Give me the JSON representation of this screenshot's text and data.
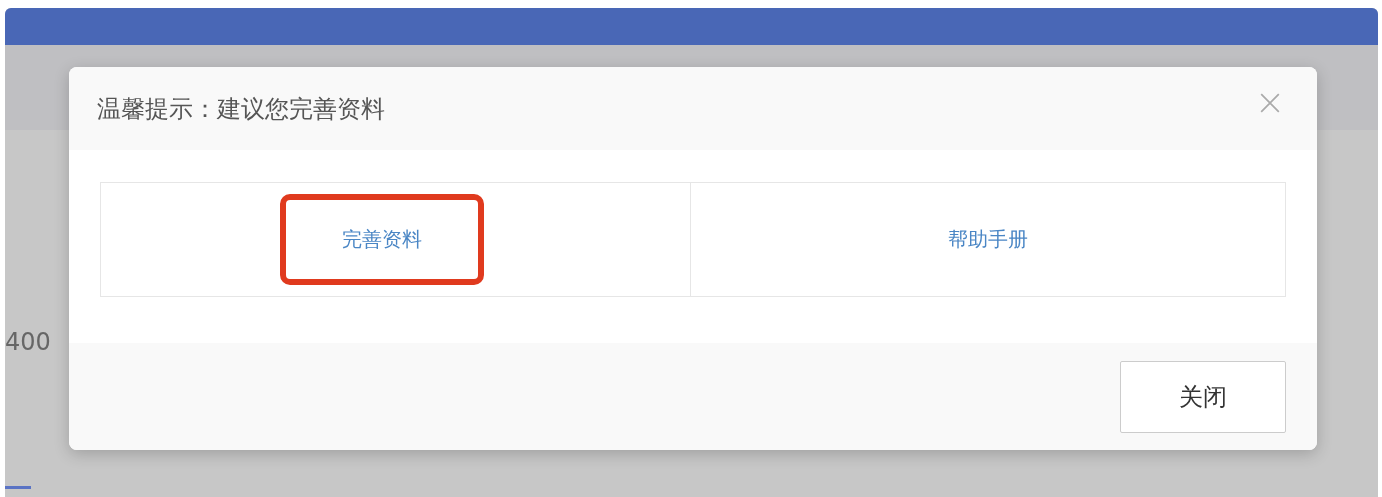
{
  "background": {
    "axis_label": "400"
  },
  "dialog": {
    "title": "温馨提示：建议您完善资料",
    "links": [
      {
        "label": "完善资料",
        "highlighted": true
      },
      {
        "label": "帮助手册",
        "highlighted": false
      }
    ],
    "buttons": [
      {
        "label": "关闭"
      }
    ]
  }
}
